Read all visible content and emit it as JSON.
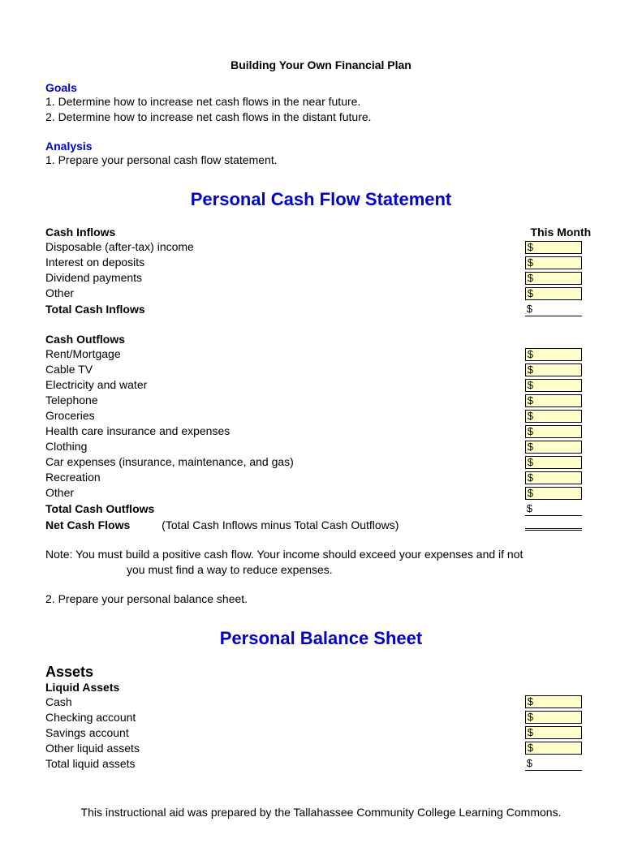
{
  "title": "Building Your Own Financial Plan",
  "goals": {
    "heading": "Goals",
    "items": [
      "1. Determine how to increase net cash flows in the near future.",
      "2. Determine how to increase net cash flows in the distant future."
    ]
  },
  "analysis": {
    "heading": "Analysis",
    "item1": "1. Prepare your personal cash flow statement."
  },
  "cashflow": {
    "title": "Personal Cash Flow Statement",
    "col_header": "This Month",
    "inflows_heading": "Cash Inflows",
    "inflows": [
      "Disposable (after-tax) income",
      "Interest on deposits",
      "Dividend payments",
      "Other"
    ],
    "total_inflows": "Total Cash Inflows",
    "outflows_heading": "Cash Outflows",
    "outflows": [
      "Rent/Mortgage",
      "Cable TV",
      "Electricity and water",
      "Telephone",
      "Groceries",
      "Health care insurance and expenses",
      "Clothing",
      "Car expenses (insurance, maintenance, and gas)",
      "Recreation",
      "Other"
    ],
    "total_outflows": "Total Cash Outflows",
    "net_label": "Net Cash Flows",
    "net_note": "(Total Cash Inflows minus Total Cash Outflows)",
    "currency": "$"
  },
  "note": {
    "line1": "Note: You must build a positive cash flow.  Your income should exceed your expenses and if not",
    "line2": "you must find a way to reduce expenses."
  },
  "analysis2": "2. Prepare your personal balance sheet.",
  "balance": {
    "title": "Personal Balance Sheet",
    "assets_heading": "Assets",
    "liquid_heading": "Liquid Assets",
    "liquid": [
      "Cash",
      "Checking account",
      "Savings account",
      "Other liquid assets"
    ],
    "total_liquid": "Total liquid assets",
    "currency": "$"
  },
  "footer": "This instructional aid was prepared by the Tallahassee Community College Learning Commons."
}
